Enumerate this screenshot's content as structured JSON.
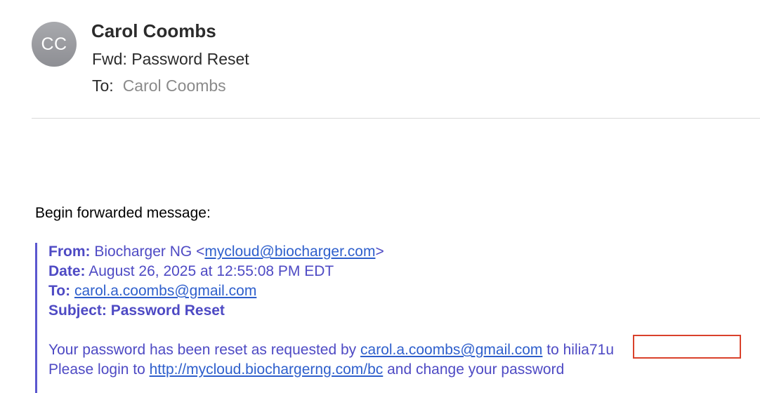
{
  "header": {
    "avatar_initials": "CC",
    "sender_name": "Carol Coombs",
    "subject": "Fwd: Password Reset",
    "to_label": "To:",
    "to_value": "Carol Coombs"
  },
  "body": {
    "forward_intro": "Begin forwarded message:",
    "forwarded": {
      "from_label": "From:",
      "from_name": "Biocharger NG <",
      "from_email": "mycloud@biocharger.com",
      "from_close": ">",
      "date_label": "Date:",
      "date_value": "August 26, 2025 at 12:55:08 PM EDT",
      "to_label": "To:",
      "to_email": "carol.a.coombs@gmail.com",
      "subject_label": "Subject:",
      "subject_value": "Password Reset",
      "message_line1_prefix": "Your password has been reset as requested by ",
      "message_line1_email": "carol.a.coombs@gmail.com",
      "message_line1_to": " to ",
      "message_line1_password": "hilia71u",
      "message_line2_prefix": "Please login to ",
      "message_line2_link": "http://mycloud.biochargerng.com/bc",
      "message_line2_suffix": " and change your password"
    }
  },
  "colors": {
    "quote_text": "#4e4ac4",
    "link": "#2e5fcc",
    "quote_bar": "#5b57cf",
    "highlight_box": "#d9412b",
    "avatar_bg": "#9a9b9f"
  }
}
